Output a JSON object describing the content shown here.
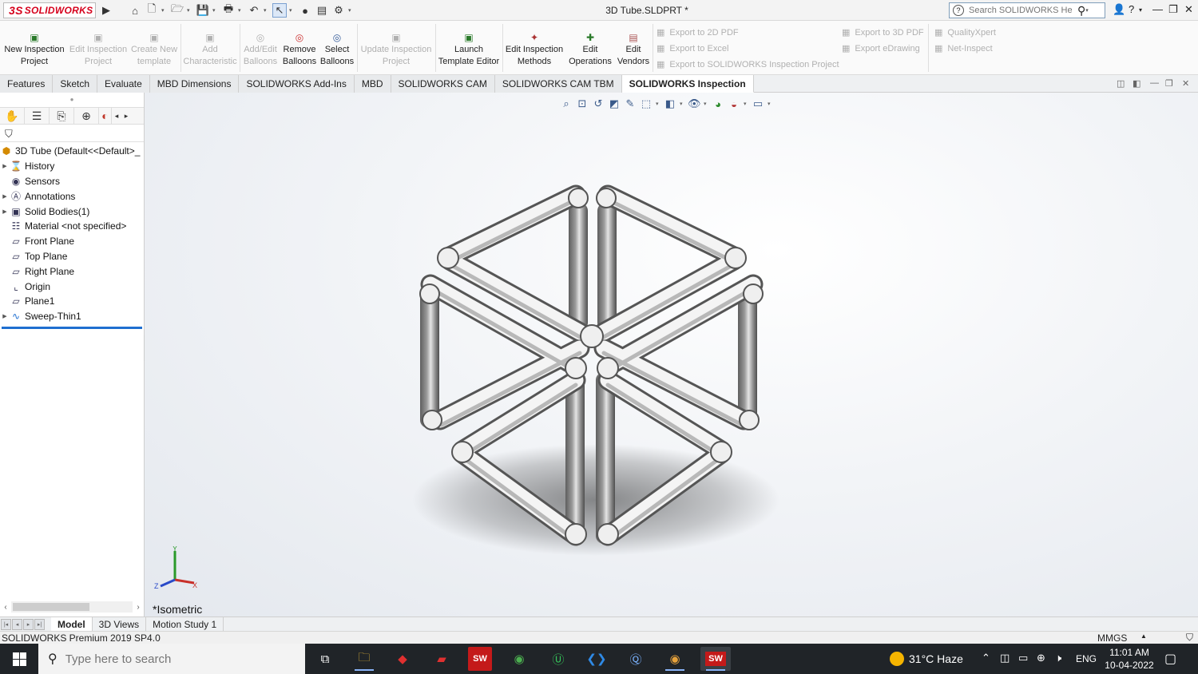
{
  "app": {
    "logo": "SOLIDWORKS",
    "logo_mark": "3S",
    "doc_title": "3D Tube.SLDPRT *"
  },
  "help_search": {
    "placeholder": "Search SOLIDWORKS Help"
  },
  "ribbon": {
    "large_buttons": [
      {
        "line1": "New Inspection",
        "line2": "Project",
        "enabled": true
      },
      {
        "line1": "Edit Inspection",
        "line2": "Project",
        "enabled": false
      },
      {
        "line1": "Create New",
        "line2": "template",
        "enabled": false
      },
      {
        "line1": "Add",
        "line2": "Characteristic",
        "enabled": false
      },
      {
        "line1": "Add/Edit",
        "line2": "Balloons",
        "enabled": false
      },
      {
        "line1": "Remove",
        "line2": "Balloons",
        "enabled": true
      },
      {
        "line1": "Select",
        "line2": "Balloons",
        "enabled": true
      },
      {
        "line1": "Update Inspection",
        "line2": "Project",
        "enabled": false
      },
      {
        "line1": "Launch",
        "line2": "Template Editor",
        "enabled": true
      },
      {
        "line1": "Edit Inspection",
        "line2": "Methods",
        "enabled": true
      },
      {
        "line1": "Edit",
        "line2": "Operations",
        "enabled": true
      },
      {
        "line1": "Edit",
        "line2": "Vendors",
        "enabled": true
      }
    ],
    "small_buttons": [
      {
        "label": "Export to 2D PDF"
      },
      {
        "label": "Export to Excel"
      },
      {
        "label": "Export to SOLIDWORKS Inspection Project"
      },
      {
        "label": "Export to 3D PDF"
      },
      {
        "label": "Export eDrawing"
      },
      {
        "label": "QualityXpert"
      },
      {
        "label": "Net-Inspect"
      }
    ]
  },
  "command_tabs": [
    "Features",
    "Sketch",
    "Evaluate",
    "MBD Dimensions",
    "SOLIDWORKS Add-Ins",
    "MBD",
    "SOLIDWORKS CAM",
    "SOLIDWORKS CAM TBM",
    "SOLIDWORKS Inspection"
  ],
  "active_command_tab": "SOLIDWORKS Inspection",
  "feature_tree": {
    "root": "3D Tube  (Default<<Default>_",
    "items": [
      {
        "label": "History",
        "icon": "history-icon",
        "expandable": true
      },
      {
        "label": "Sensors",
        "icon": "sensor-icon",
        "expandable": false
      },
      {
        "label": "Annotations",
        "icon": "annotation-icon",
        "expandable": true
      },
      {
        "label": "Solid Bodies(1)",
        "icon": "solid-body-icon",
        "expandable": true
      },
      {
        "label": "Material <not specified>",
        "icon": "material-icon",
        "expandable": false
      },
      {
        "label": "Front Plane",
        "icon": "plane-icon",
        "expandable": false
      },
      {
        "label": "Top Plane",
        "icon": "plane-icon",
        "expandable": false
      },
      {
        "label": "Right Plane",
        "icon": "plane-icon",
        "expandable": false
      },
      {
        "label": "Origin",
        "icon": "origin-icon",
        "expandable": false
      },
      {
        "label": "Plane1",
        "icon": "plane-icon",
        "expandable": false
      },
      {
        "label": "Sweep-Thin1",
        "icon": "sweep-icon",
        "expandable": true
      }
    ]
  },
  "viewport": {
    "view_name": "*Isometric",
    "triad": {
      "x": "X",
      "y": "Y",
      "z": "Z"
    }
  },
  "bottom_tabs": [
    "Model",
    "3D Views",
    "Motion Study 1"
  ],
  "active_bottom_tab": "Model",
  "status": {
    "text": "SOLIDWORKS Premium 2019 SP4.0",
    "units": "MMGS"
  },
  "taskbar": {
    "search_placeholder": "Type here to search",
    "weather": "31°C  Haze",
    "language": "ENG",
    "time": "11:01 AM",
    "date": "10-04-2022",
    "apps": [
      "task-view-icon",
      "file-explorer-icon",
      "app-red-icon",
      "app-dark-icon",
      "solidworks-2019-icon",
      "chrome-icon",
      "upwork-icon",
      "vscode-icon",
      "zoom-search-icon",
      "chrome-profile-icon",
      "solidworks-2019-active-icon"
    ]
  },
  "colors": {
    "accent": "#1f6fd0",
    "brand_red": "#d6001c",
    "tube_light": "#f2f2f2",
    "tube_dark": "#6e6e6e",
    "taskbar": "#202428"
  }
}
